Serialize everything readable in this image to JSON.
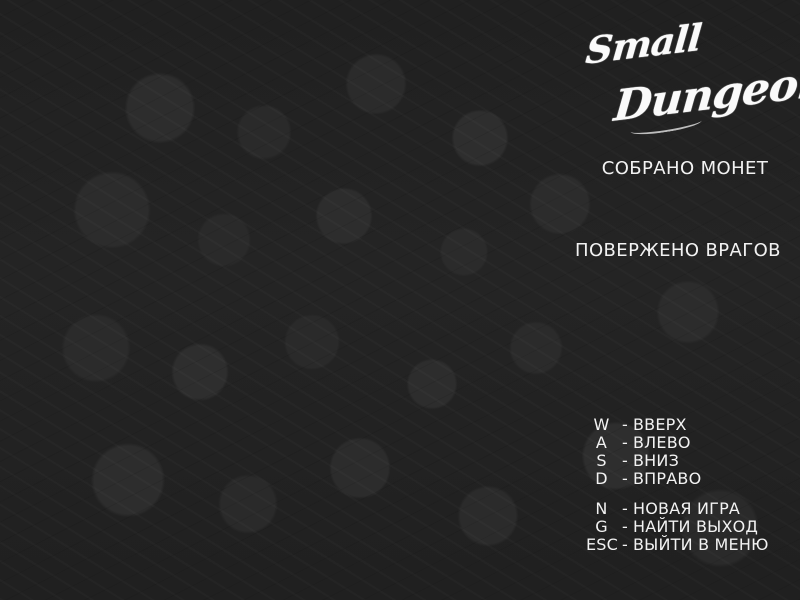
{
  "game": {
    "logo": {
      "line_one": "Small",
      "line_two": "Dungeon"
    },
    "stats": {
      "coins_label": "СОБРАНО МОНЕТ",
      "enemies_label": "ПОВЕРЖЕНО ВРАГОВ"
    },
    "controls": [
      {
        "key": "W",
        "separator": "-",
        "action": "ВВЕРХ"
      },
      {
        "key": "A",
        "separator": "-",
        "action": "ВЛЕВО"
      },
      {
        "key": "S",
        "separator": "-",
        "action": "ВНИЗ"
      },
      {
        "key": "D",
        "separator": "-",
        "action": "ВПРАВО"
      },
      {
        "key": "N",
        "separator": "-",
        "action": "НОВАЯ ИГРА"
      },
      {
        "key": "G",
        "separator": "-",
        "action": "НАЙТИ ВЫХОД"
      },
      {
        "key": "ESC",
        "separator": "-",
        "action": "ВЫЙТИ В МЕНЮ"
      }
    ]
  },
  "theme": {
    "background": "#262626",
    "text": "#f2f2f2"
  }
}
